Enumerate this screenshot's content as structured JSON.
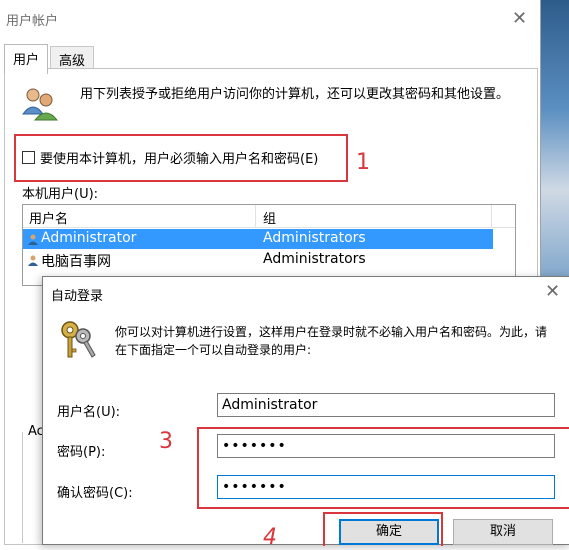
{
  "back_window": {
    "title": "用户帐户",
    "tabs": [
      {
        "label": "用户"
      },
      {
        "label": "高级"
      }
    ],
    "description": "用下列表授予或拒绝用户访问你的计算机，还可以更改其密码和其他设置。",
    "checkbox_label": "要使用本计算机，用户必须输入用户名和密码(E)",
    "checkbox_checked": false,
    "local_users_label": "本机用户(U):",
    "columns": [
      "用户名",
      "组"
    ],
    "rows": [
      {
        "name": "Administrator",
        "group": "Administrators",
        "selected": true
      },
      {
        "name": "电脑百事网",
        "group": "Administrators",
        "selected": false
      }
    ],
    "groupbox_fragment": "Ac"
  },
  "dialog": {
    "title": "自动登录",
    "description": "你可以对计算机进行设置，这样用户在登录时就不必输入用户名和密码。为此，请在下面指定一个可以自动登录的用户:",
    "username_label": "用户名(U):",
    "username_value": "Administrator",
    "password_label": "密码(P):",
    "password_value": "•••••••",
    "confirm_label": "确认密码(C):",
    "confirm_value": "•••••••",
    "ok_label": "确定",
    "cancel_label": "取消"
  },
  "annotations": {
    "n1": "1",
    "n3": "3",
    "n4": "4",
    "color": "#d9363e"
  },
  "colors": {
    "selection": "#3399ff",
    "focus": "#0078d7",
    "annotation": "#d9363e"
  }
}
